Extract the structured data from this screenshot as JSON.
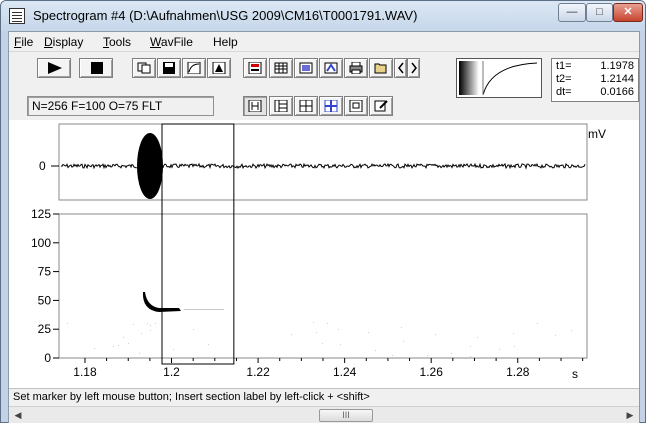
{
  "window": {
    "title": "Spectrogram #4 (D:\\Aufnahmen\\USG 2009\\CM16\\T0001791.WAV)",
    "minimize_icon": "minimize-icon",
    "maximize_icon": "maximize-icon",
    "close_icon": "close-icon"
  },
  "menu": {
    "items": [
      {
        "first": "F",
        "rest": "ile"
      },
      {
        "first": "D",
        "rest": "isplay"
      },
      {
        "first": "T",
        "rest": "ools"
      },
      {
        "first": "W",
        "rest": "avFile"
      },
      {
        "first": "",
        "rest": "Help"
      }
    ]
  },
  "toolbar": {
    "params_text": "N=256 F=100 O=75 FLT",
    "icons": [
      "play-icon",
      "stop-icon",
      "copy-icon",
      "save-icon",
      "envelope-icon",
      "triangle-icon",
      "calc-icon",
      "grid-icon",
      "zoom-icon",
      "filter-icon",
      "print-icon",
      "open-icon",
      "prev-icon",
      "next-icon",
      "window1-icon",
      "window2-icon",
      "window3-icon",
      "window4-icon",
      "window5-icon",
      "edit-icon"
    ]
  },
  "readout": {
    "t1_label": "t1=",
    "t1_value": "1.1978",
    "t2_label": "t2=",
    "t2_value": "1.2144",
    "dt_label": "dt=",
    "dt_value": "0.0166"
  },
  "waveform": {
    "unit": "mV",
    "zero_label": "0"
  },
  "chart_data": {
    "type": "heatmap",
    "y_ticks": [
      "125",
      "100",
      "75",
      "50",
      "25",
      "0"
    ],
    "x_ticks": [
      "1.18",
      "1.2",
      "1.22",
      "1.24",
      "1.26",
      "1.28"
    ],
    "x_unit": "s",
    "ylim": [
      0,
      125
    ],
    "xlim": [
      1.174,
      1.296
    ],
    "selection": {
      "t1": 1.1978,
      "t2": 1.2144
    }
  },
  "statusbar": {
    "text": "Set marker by left mouse button; Insert section label by left-click + <shift>"
  },
  "hscroll": {
    "thumb_label": "III"
  },
  "colors": {
    "accent": "#c3d3e5",
    "close": "#c7442e",
    "signal": "#000000"
  }
}
